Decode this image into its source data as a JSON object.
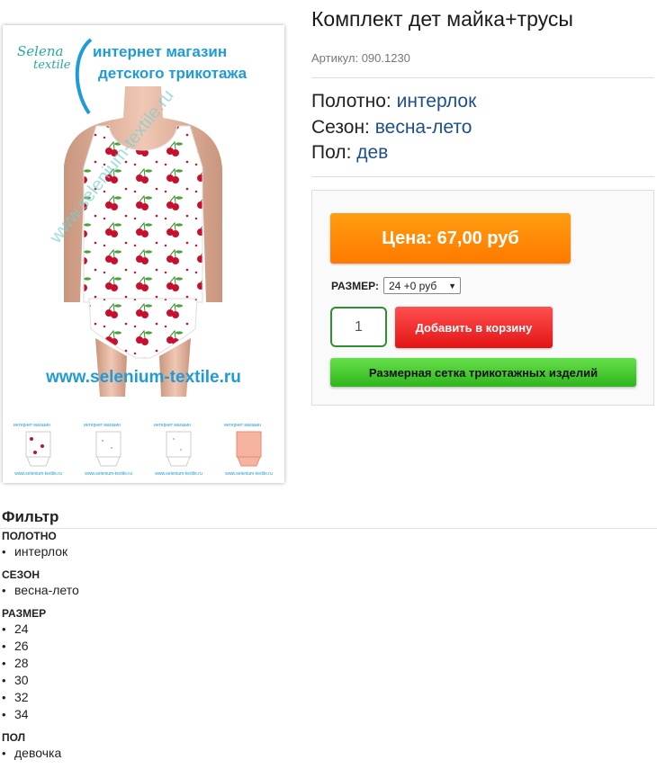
{
  "product": {
    "title": "Комплект дет майка+трусы",
    "sku": "Артикул: 090.1230",
    "attributes": [
      {
        "label": "Полотно: ",
        "value": "интерлок"
      },
      {
        "label": "Сезон: ",
        "value": "весна-лето"
      },
      {
        "label": "Пол: ",
        "value": "дев"
      }
    ]
  },
  "image": {
    "logo_top": "Selena",
    "logo_bottom": "textile",
    "shop_line1": "интернет магазин",
    "shop_line2": "детского трикотажа",
    "site_url": "www.selenium-textile.ru",
    "watermark": "www.selenium-textile.ru"
  },
  "thumbs": [
    {
      "top": "интернет магазин",
      "bottom": "www.selenium-textile.ru"
    },
    {
      "top": "интернет магазин",
      "bottom": "www.selenium-textile.ru"
    },
    {
      "top": "интернет магазин",
      "bottom": "www.selenium-textile.ru"
    },
    {
      "top": "интернет магазин",
      "bottom": "www.selenium-textile.ru"
    }
  ],
  "buy": {
    "price_label": "Цена: 67,00 руб",
    "size_label": "РАЗМЕР:",
    "size_selected": "24 +0 руб",
    "quantity": "1",
    "add_to_cart": "Добавить в корзину",
    "size_grid": "Размерная сетка трикотажных изделий"
  },
  "filter": {
    "title": "Фильтр",
    "groups": [
      {
        "title": "ПОЛОТНО",
        "items": [
          "интерлок"
        ]
      },
      {
        "title": "СЕЗОН",
        "items": [
          "весна-лето"
        ]
      },
      {
        "title": "РАЗМЕР",
        "items": [
          "24",
          "26",
          "28",
          "30",
          "32",
          "34"
        ]
      },
      {
        "title": "ПОЛ",
        "items": [
          "девочка"
        ]
      }
    ]
  },
  "colors": {
    "accent_blue": "#1e4e8c",
    "price_orange": "#ff8a00",
    "cart_red": "#e31414",
    "grid_green": "#3cc226"
  }
}
